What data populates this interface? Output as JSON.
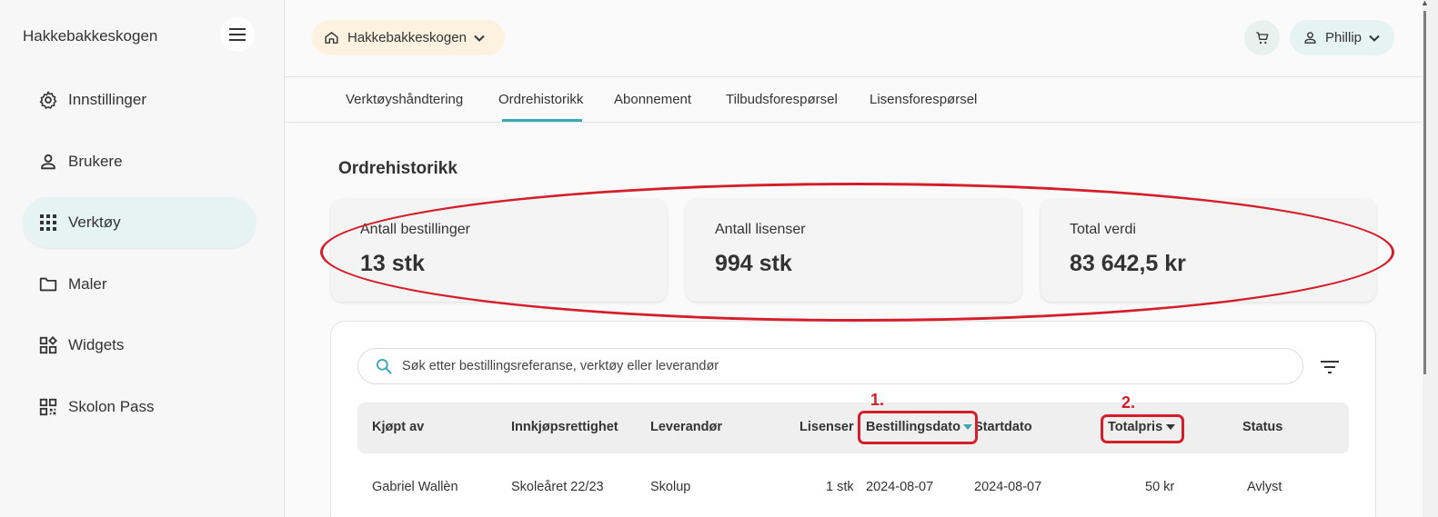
{
  "sidebar": {
    "brand": "Hakkebakkeskogen",
    "items": [
      {
        "label": "Innstillinger",
        "icon": "gear-icon"
      },
      {
        "label": "Brukere",
        "icon": "person-icon"
      },
      {
        "label": "Verktøy",
        "icon": "grid-icon",
        "active": true
      },
      {
        "label": "Maler",
        "icon": "folder-icon"
      },
      {
        "label": "Widgets",
        "icon": "widgets-icon"
      },
      {
        "label": "Skolon Pass",
        "icon": "qr-icon"
      }
    ]
  },
  "header": {
    "org_label": "Hakkebakkeskogen",
    "user_label": "Phillip"
  },
  "tabs": [
    {
      "label": "Verktøyshåndtering"
    },
    {
      "label": "Ordrehistorikk",
      "active": true
    },
    {
      "label": "Abonnement"
    },
    {
      "label": "Tilbudsforespørsel"
    },
    {
      "label": "Lisensforespørsel"
    }
  ],
  "main": {
    "title": "Ordrehistorikk",
    "stats": [
      {
        "label": "Antall bestillinger",
        "value": "13 stk"
      },
      {
        "label": "Antall lisenser",
        "value": "994 stk"
      },
      {
        "label": "Total verdi",
        "value": "83 642,5 kr"
      }
    ],
    "search_placeholder": "Søk etter bestillingsreferanse, verktøy eller leverandør",
    "columns": [
      "Kjøpt av",
      "Innkjøpsrettighet",
      "Leverandør",
      "Lisenser",
      "Bestillingsdato",
      "Startdato",
      "Totalpris",
      "Status"
    ],
    "rows": [
      [
        "Gabriel Wallèn",
        "Skoleåret 22/23",
        "Skolup",
        "1 stk",
        "2024-08-07",
        "2024-08-07",
        "50 kr",
        "Avlyst"
      ]
    ]
  },
  "annotations": {
    "marker_1": "1.",
    "marker_2": "2."
  },
  "colors": {
    "accent": "#3aa8b4",
    "annotation": "#d41e2a",
    "active_nav_bg": "#e6f3f3",
    "org_select_bg": "#fdf2e0"
  }
}
